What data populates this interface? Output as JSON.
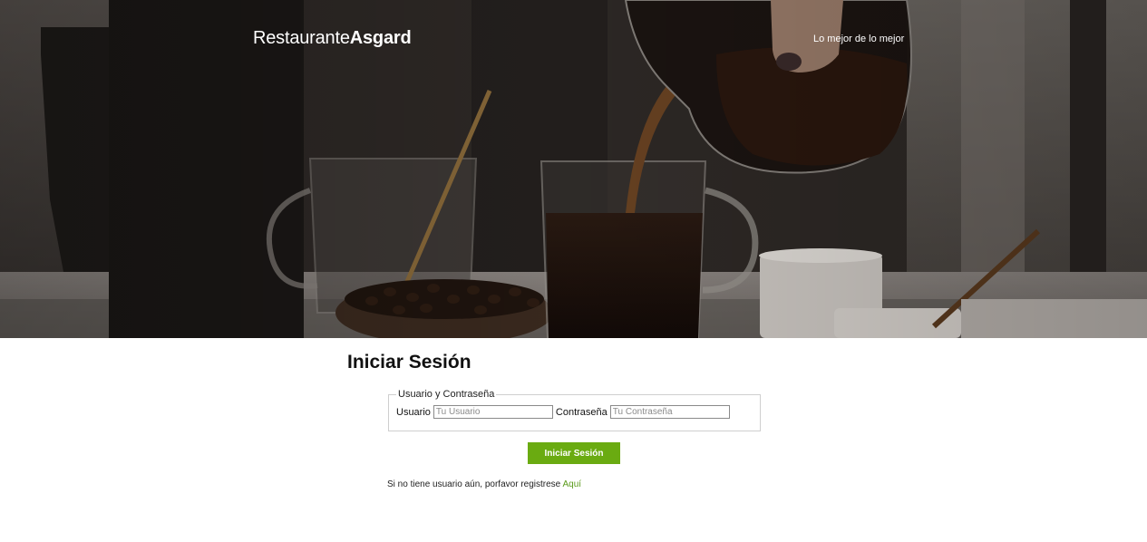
{
  "header": {
    "brand_light": "Restaurante",
    "brand_bold": "Asgard",
    "tagline": "Lo mejor de lo mejor"
  },
  "hero": {
    "image_subject": "coffee-pouring-photo"
  },
  "login": {
    "title": "Iniciar Sesión",
    "fieldset_legend": "Usuario y Contraseña",
    "user_label": "Usuario",
    "user_placeholder": "Tu Usuario",
    "user_value": "",
    "password_label": "Contraseña",
    "password_placeholder": "Tu Contraseña",
    "password_value": "",
    "submit_label": "Iniciar Sesión"
  },
  "register": {
    "text": "Si no tiene usuario aún, porfavor registrese",
    "link_label": "Aquí"
  },
  "colors": {
    "accent": "#6aab11",
    "link": "#5a9a1a",
    "hero_dark": "#1d1917"
  }
}
